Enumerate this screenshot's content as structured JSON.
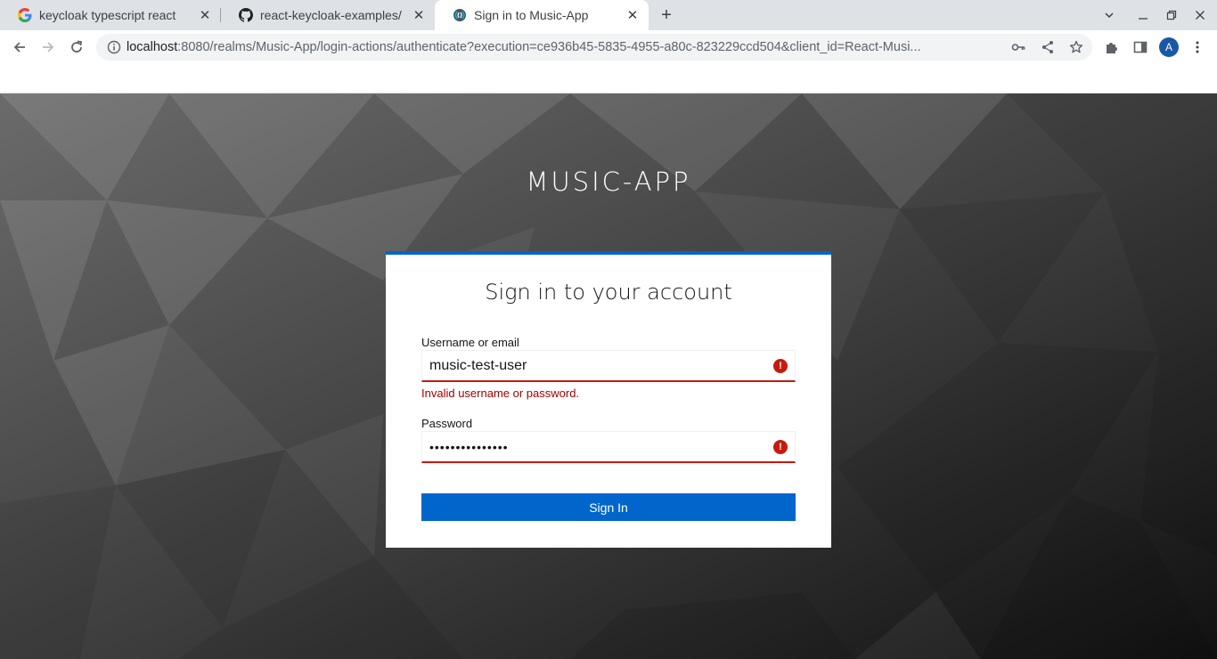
{
  "tabs": [
    {
      "title": "keycloak typescript react",
      "favicon": "google-icon",
      "active": false
    },
    {
      "title": "react-keycloak-examples/",
      "favicon": "github-icon",
      "active": false
    },
    {
      "title": "Sign in to Music-App",
      "favicon": "keycloak-icon",
      "active": true
    }
  ],
  "address_bar": {
    "host": "localhost",
    "rest": ":8080/realms/Music-App/login-actions/authenticate?execution=ce936b45-5835-4955-a80c-823229ccd504&client_id=React-Musi..."
  },
  "profile": {
    "initial": "A"
  },
  "login": {
    "realm_title": "MUSIC-APP",
    "card_title": "Sign in to your account",
    "username_label": "Username or email",
    "username_value": "music-test-user",
    "error_message": "Invalid username or password.",
    "password_label": "Password",
    "password_value": "•••••••••••••••",
    "submit_label": "Sign In"
  },
  "colors": {
    "accent": "#0066cc",
    "error": "#c9190b",
    "error_text": "#a30000",
    "avatar": "#1a57a6"
  }
}
